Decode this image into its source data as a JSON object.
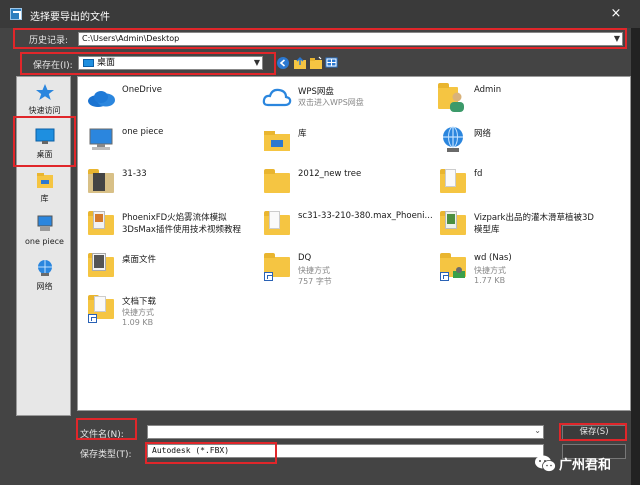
{
  "window": {
    "title": "选择要导出的文件",
    "close": "×"
  },
  "history": {
    "label": "历史记录:",
    "value": "C:\\Users\\Admin\\Desktop"
  },
  "save_in": {
    "label": "保存在(I):",
    "value": "桌面"
  },
  "places": [
    {
      "label": "快速访问",
      "icon": "star-icon"
    },
    {
      "label": "桌面",
      "icon": "desktop-icon"
    },
    {
      "label": "库",
      "icon": "library-icon"
    },
    {
      "label": "one piece",
      "icon": "computer-icon"
    },
    {
      "label": "网络",
      "icon": "network-icon"
    }
  ],
  "items": [
    {
      "l1": "OneDrive",
      "icon": "onedrive-icon"
    },
    {
      "l1": "WPS网盘",
      "m1": "双击进入WPS网盘",
      "icon": "wps-cloud-icon"
    },
    {
      "l1": "Admin",
      "icon": "user-folder-icon"
    },
    {
      "l1": "one piece",
      "icon": "computer-icon"
    },
    {
      "l1": "库",
      "icon": "library-icon"
    },
    {
      "l1": "网络",
      "icon": "network-icon"
    },
    {
      "l1": "31-33",
      "icon": "folder-icon"
    },
    {
      "l1": "2012_new tree",
      "icon": "folder-icon"
    },
    {
      "l1": "fd",
      "icon": "folder-icon"
    },
    {
      "l1": "PhoenixFD火焰雾流体模拟",
      "l2": "3DsMax插件使用技术视频教程",
      "icon": "folder-icon"
    },
    {
      "l1": "sc31-33-210-380.max_Phoeni...",
      "icon": "folder-icon"
    },
    {
      "l1": "Vizpark出品的灌木滑草植被3D",
      "l2": "模型库",
      "icon": "folder-icon"
    },
    {
      "l1": "桌面文件",
      "icon": "folder-icon"
    },
    {
      "l1": "DQ",
      "m1": "快捷方式",
      "m2": "757 字节",
      "icon": "shortcut-folder-icon"
    },
    {
      "l1": "wd (Nas)",
      "m1": "快捷方式",
      "m2": "1.77 KB",
      "icon": "shortcut-folder-icon"
    },
    {
      "l1": "文档下载",
      "m1": "快捷方式",
      "m2": "1.09 KB",
      "icon": "shortcut-folder-icon"
    }
  ],
  "filename": {
    "label": "文件名(N):",
    "value": ""
  },
  "filetype": {
    "label": "保存类型(T):",
    "value": "Autodesk (*.FBX)"
  },
  "buttons": {
    "save": "保存(S)"
  },
  "watermark": {
    "text": "广州君和"
  },
  "colors": {
    "highlight": "#e0262a",
    "folder": "#f5c542",
    "accent": "#1e8fe0"
  }
}
